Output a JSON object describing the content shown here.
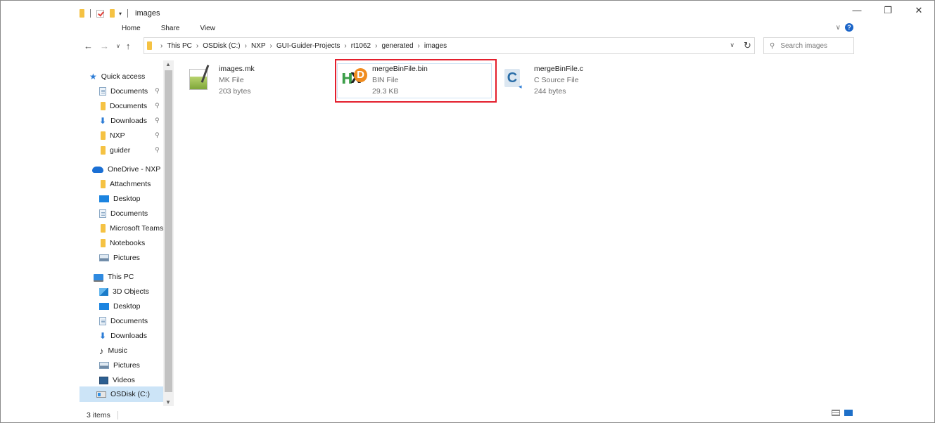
{
  "window": {
    "title": "images",
    "controls": {
      "minimize": "—",
      "maximize": "❐",
      "close": "✕"
    }
  },
  "ribbon": {
    "tabs": [
      "Home",
      "Share",
      "View"
    ],
    "expand": "∨",
    "help": "?"
  },
  "address_bar": {
    "breadcrumbs": [
      "This PC",
      "OSDisk (C:)",
      "NXP",
      "GUI-Guider-Projects",
      "rt1062",
      "generated",
      "images"
    ],
    "separator": "›",
    "dropdown": "∨",
    "refresh": "↻"
  },
  "nav_buttons": {
    "back": "←",
    "forward": "→",
    "recent": "∨",
    "up": "↑"
  },
  "search": {
    "placeholder": "Search images",
    "icon": "search-icon"
  },
  "nav_pane": {
    "quick_access": {
      "label": "Quick access",
      "items": [
        {
          "label": "Documents",
          "icon": "document-icon",
          "pinned": true
        },
        {
          "label": "Documents",
          "icon": "folder-icon",
          "pinned": true
        },
        {
          "label": "Downloads",
          "icon": "download-icon",
          "pinned": true
        },
        {
          "label": "NXP",
          "icon": "folder-icon",
          "pinned": true
        },
        {
          "label": "guider",
          "icon": "folder-icon",
          "pinned": true
        }
      ]
    },
    "onedrive": {
      "label": "OneDrive - NXP",
      "items": [
        {
          "label": "Attachments",
          "icon": "folder-icon"
        },
        {
          "label": "Desktop",
          "icon": "desktop-icon"
        },
        {
          "label": "Documents",
          "icon": "document-icon"
        },
        {
          "label": "Microsoft Teams",
          "icon": "folder-icon"
        },
        {
          "label": "Notebooks",
          "icon": "folder-icon"
        },
        {
          "label": "Pictures",
          "icon": "pictures-icon"
        }
      ]
    },
    "this_pc": {
      "label": "This PC",
      "items": [
        {
          "label": "3D Objects",
          "icon": "3d-objects-icon"
        },
        {
          "label": "Desktop",
          "icon": "desktop-icon"
        },
        {
          "label": "Documents",
          "icon": "document-icon"
        },
        {
          "label": "Downloads",
          "icon": "download-icon"
        },
        {
          "label": "Music",
          "icon": "music-icon"
        },
        {
          "label": "Pictures",
          "icon": "pictures-icon"
        },
        {
          "label": "Videos",
          "icon": "videos-icon"
        },
        {
          "label": "OSDisk (C:)",
          "icon": "disk-icon",
          "selected": true
        }
      ]
    },
    "pin_glyph": "📌"
  },
  "files": [
    {
      "name": "images.mk",
      "type": "MK File",
      "size": "203 bytes",
      "icon": "mk-file-icon"
    },
    {
      "name": "mergeBinFile.bin",
      "type": "BIN File",
      "size": "29.3 KB",
      "icon": "hxd-bin-icon",
      "highlighted": true
    },
    {
      "name": "mergeBinFile.c",
      "type": "C Source File",
      "size": "244 bytes",
      "icon": "c-source-icon"
    }
  ],
  "status_bar": {
    "item_count": "3 items"
  },
  "colors": {
    "highlight_border": "#e41f2d",
    "accent": "#1a64c8",
    "folder": "#f5c243"
  }
}
